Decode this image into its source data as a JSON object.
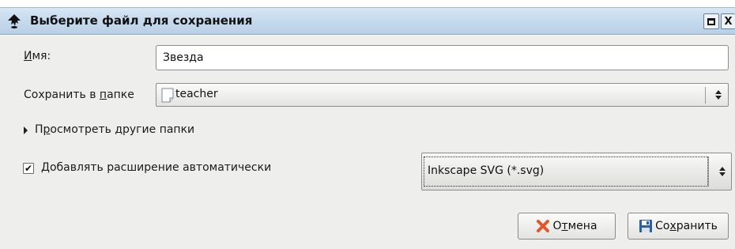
{
  "window": {
    "title": "Выберите файл для сохранения",
    "title_icon": "inkscape-logo-icon",
    "maximize_icon": "maximize-icon",
    "close_label": "X"
  },
  "name_row": {
    "label_mnemonic": "И",
    "label_rest": "мя:",
    "value": "Звезда"
  },
  "folder_row": {
    "label_before": "Сохранить в ",
    "label_mnemonic": "п",
    "label_after": "апке",
    "value": "teacher",
    "icon": "document-icon"
  },
  "expander": {
    "label_before": "П",
    "label_mnemonic": "р",
    "label_after": "осмотреть другие папки"
  },
  "auto_extension": {
    "checked": true,
    "check_mark": "✔",
    "label": "Добавлять расширение автоматически"
  },
  "file_type": {
    "selected": "Inkscape SVG (*.svg)"
  },
  "buttons": {
    "cancel": {
      "before": "О",
      "mnemonic": "т",
      "after": "мена",
      "icon": "cancel-x-icon"
    },
    "save": {
      "before": "Со",
      "mnemonic": "х",
      "after": "ранить",
      "icon": "floppy-disk-icon"
    }
  },
  "colors": {
    "titlebar": "#c4d8ec",
    "dialog_bg": "#eeeeec",
    "cancel_icon": "#e2562c",
    "save_icon": "#2b5fa8"
  }
}
